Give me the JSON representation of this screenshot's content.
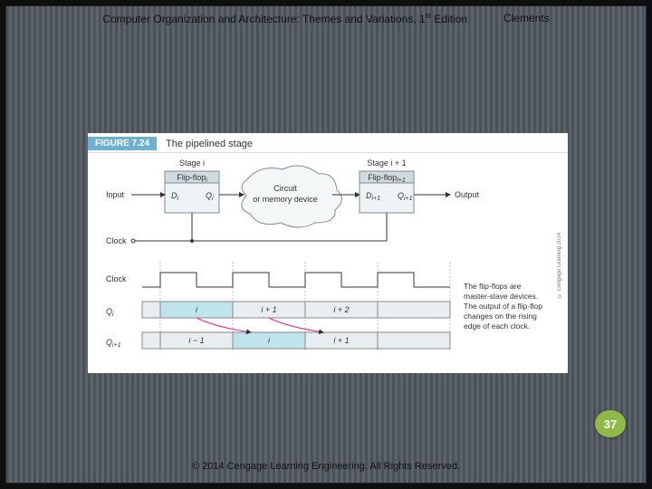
{
  "header": {
    "title_main": "Computer Organization and Architecture: Themes and Variations, 1",
    "title_sup": "st",
    "title_tail": " Edition",
    "author": "Clements"
  },
  "figure": {
    "tag": "FIGURE 7.24",
    "caption": "The pipelined stage",
    "stage_i": "Stage i",
    "stage_i1": "Stage i + 1",
    "ff_i": "Flip-flop",
    "ff_i_sub": "i",
    "ff_i1": "Flip-flop",
    "ff_i1_sub": "i+1",
    "input": "Input",
    "output": "Output",
    "D_i": "D",
    "D_i_sub": "i",
    "Q_i": "Q",
    "Q_i_sub": "i",
    "D_i1": "D",
    "D_i1_sub": "i+1",
    "Q_i1": "Q",
    "Q_i1_sub": "i+1",
    "circuit_l1": "Circuit",
    "circuit_l2": "or memory device",
    "clock": "Clock",
    "note_l1": "The flip-flops are",
    "note_l2": "master-slave devices.",
    "note_l3": "The output of a flip-flop",
    "note_l4": "changes on the rising",
    "note_l5": "edge of each clock.",
    "wave_q": "Q",
    "wave_q_sub": "i",
    "wave_q1": "Q",
    "wave_q1_sub": "i+1",
    "seg_im1": "i − 1",
    "seg_i": "i",
    "seg_i1": "i + 1",
    "seg_i2": "i + 2",
    "credit": "© Cengage Learning 2014"
  },
  "page_number": "37",
  "copyright": "© 2014 Cengage Learning Engineering. All Rights Reserved."
}
